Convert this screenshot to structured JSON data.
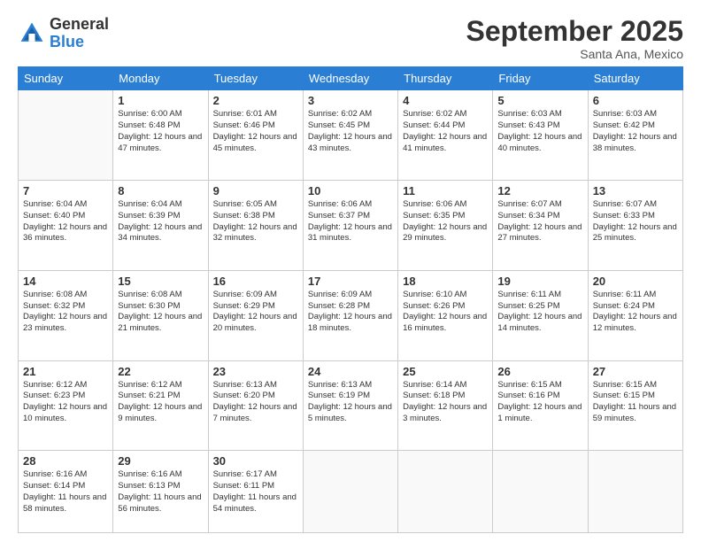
{
  "header": {
    "logo": {
      "general": "General",
      "blue": "Blue"
    },
    "title": "September 2025",
    "location": "Santa Ana, Mexico"
  },
  "weekdays": [
    "Sunday",
    "Monday",
    "Tuesday",
    "Wednesday",
    "Thursday",
    "Friday",
    "Saturday"
  ],
  "weeks": [
    [
      {
        "day": "",
        "empty": true
      },
      {
        "day": "1",
        "sunrise": "Sunrise: 6:00 AM",
        "sunset": "Sunset: 6:48 PM",
        "daylight": "Daylight: 12 hours and 47 minutes."
      },
      {
        "day": "2",
        "sunrise": "Sunrise: 6:01 AM",
        "sunset": "Sunset: 6:46 PM",
        "daylight": "Daylight: 12 hours and 45 minutes."
      },
      {
        "day": "3",
        "sunrise": "Sunrise: 6:02 AM",
        "sunset": "Sunset: 6:45 PM",
        "daylight": "Daylight: 12 hours and 43 minutes."
      },
      {
        "day": "4",
        "sunrise": "Sunrise: 6:02 AM",
        "sunset": "Sunset: 6:44 PM",
        "daylight": "Daylight: 12 hours and 41 minutes."
      },
      {
        "day": "5",
        "sunrise": "Sunrise: 6:03 AM",
        "sunset": "Sunset: 6:43 PM",
        "daylight": "Daylight: 12 hours and 40 minutes."
      },
      {
        "day": "6",
        "sunrise": "Sunrise: 6:03 AM",
        "sunset": "Sunset: 6:42 PM",
        "daylight": "Daylight: 12 hours and 38 minutes."
      }
    ],
    [
      {
        "day": "7",
        "sunrise": "Sunrise: 6:04 AM",
        "sunset": "Sunset: 6:40 PM",
        "daylight": "Daylight: 12 hours and 36 minutes."
      },
      {
        "day": "8",
        "sunrise": "Sunrise: 6:04 AM",
        "sunset": "Sunset: 6:39 PM",
        "daylight": "Daylight: 12 hours and 34 minutes."
      },
      {
        "day": "9",
        "sunrise": "Sunrise: 6:05 AM",
        "sunset": "Sunset: 6:38 PM",
        "daylight": "Daylight: 12 hours and 32 minutes."
      },
      {
        "day": "10",
        "sunrise": "Sunrise: 6:06 AM",
        "sunset": "Sunset: 6:37 PM",
        "daylight": "Daylight: 12 hours and 31 minutes."
      },
      {
        "day": "11",
        "sunrise": "Sunrise: 6:06 AM",
        "sunset": "Sunset: 6:35 PM",
        "daylight": "Daylight: 12 hours and 29 minutes."
      },
      {
        "day": "12",
        "sunrise": "Sunrise: 6:07 AM",
        "sunset": "Sunset: 6:34 PM",
        "daylight": "Daylight: 12 hours and 27 minutes."
      },
      {
        "day": "13",
        "sunrise": "Sunrise: 6:07 AM",
        "sunset": "Sunset: 6:33 PM",
        "daylight": "Daylight: 12 hours and 25 minutes."
      }
    ],
    [
      {
        "day": "14",
        "sunrise": "Sunrise: 6:08 AM",
        "sunset": "Sunset: 6:32 PM",
        "daylight": "Daylight: 12 hours and 23 minutes."
      },
      {
        "day": "15",
        "sunrise": "Sunrise: 6:08 AM",
        "sunset": "Sunset: 6:30 PM",
        "daylight": "Daylight: 12 hours and 21 minutes."
      },
      {
        "day": "16",
        "sunrise": "Sunrise: 6:09 AM",
        "sunset": "Sunset: 6:29 PM",
        "daylight": "Daylight: 12 hours and 20 minutes."
      },
      {
        "day": "17",
        "sunrise": "Sunrise: 6:09 AM",
        "sunset": "Sunset: 6:28 PM",
        "daylight": "Daylight: 12 hours and 18 minutes."
      },
      {
        "day": "18",
        "sunrise": "Sunrise: 6:10 AM",
        "sunset": "Sunset: 6:26 PM",
        "daylight": "Daylight: 12 hours and 16 minutes."
      },
      {
        "day": "19",
        "sunrise": "Sunrise: 6:11 AM",
        "sunset": "Sunset: 6:25 PM",
        "daylight": "Daylight: 12 hours and 14 minutes."
      },
      {
        "day": "20",
        "sunrise": "Sunrise: 6:11 AM",
        "sunset": "Sunset: 6:24 PM",
        "daylight": "Daylight: 12 hours and 12 minutes."
      }
    ],
    [
      {
        "day": "21",
        "sunrise": "Sunrise: 6:12 AM",
        "sunset": "Sunset: 6:23 PM",
        "daylight": "Daylight: 12 hours and 10 minutes."
      },
      {
        "day": "22",
        "sunrise": "Sunrise: 6:12 AM",
        "sunset": "Sunset: 6:21 PM",
        "daylight": "Daylight: 12 hours and 9 minutes."
      },
      {
        "day": "23",
        "sunrise": "Sunrise: 6:13 AM",
        "sunset": "Sunset: 6:20 PM",
        "daylight": "Daylight: 12 hours and 7 minutes."
      },
      {
        "day": "24",
        "sunrise": "Sunrise: 6:13 AM",
        "sunset": "Sunset: 6:19 PM",
        "daylight": "Daylight: 12 hours and 5 minutes."
      },
      {
        "day": "25",
        "sunrise": "Sunrise: 6:14 AM",
        "sunset": "Sunset: 6:18 PM",
        "daylight": "Daylight: 12 hours and 3 minutes."
      },
      {
        "day": "26",
        "sunrise": "Sunrise: 6:15 AM",
        "sunset": "Sunset: 6:16 PM",
        "daylight": "Daylight: 12 hours and 1 minute."
      },
      {
        "day": "27",
        "sunrise": "Sunrise: 6:15 AM",
        "sunset": "Sunset: 6:15 PM",
        "daylight": "Daylight: 11 hours and 59 minutes."
      }
    ],
    [
      {
        "day": "28",
        "sunrise": "Sunrise: 6:16 AM",
        "sunset": "Sunset: 6:14 PM",
        "daylight": "Daylight: 11 hours and 58 minutes."
      },
      {
        "day": "29",
        "sunrise": "Sunrise: 6:16 AM",
        "sunset": "Sunset: 6:13 PM",
        "daylight": "Daylight: 11 hours and 56 minutes."
      },
      {
        "day": "30",
        "sunrise": "Sunrise: 6:17 AM",
        "sunset": "Sunset: 6:11 PM",
        "daylight": "Daylight: 11 hours and 54 minutes."
      },
      {
        "day": "",
        "empty": true
      },
      {
        "day": "",
        "empty": true
      },
      {
        "day": "",
        "empty": true
      },
      {
        "day": "",
        "empty": true
      }
    ]
  ]
}
